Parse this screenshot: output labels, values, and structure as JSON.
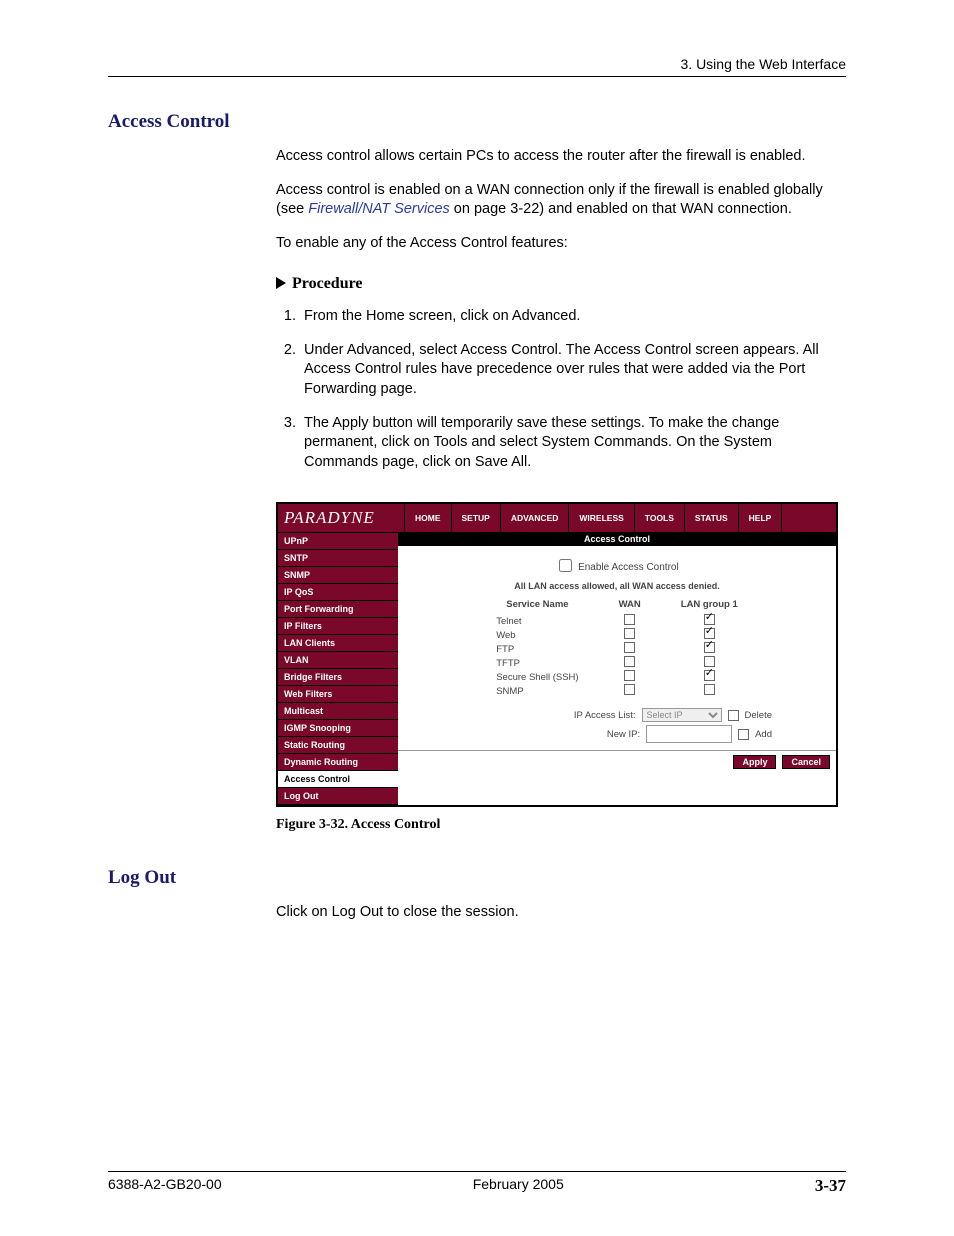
{
  "header": {
    "breadcrumb": "3. Using the Web Interface"
  },
  "sections": {
    "access_control": {
      "title": "Access Control",
      "p1": "Access control allows certain PCs to access the router after the firewall is enabled.",
      "p2_a": "Access control is enabled on a WAN connection only if the firewall is enabled globally (see ",
      "p2_link": "Firewall/NAT Services",
      "p2_b": " on page 3-22) and enabled on that WAN connection.",
      "p3": "To enable any of the Access Control features:",
      "procedure_label": "Procedure",
      "steps": [
        "From the Home screen, click on Advanced.",
        "Under Advanced, select Access Control. The Access Control screen appears. All Access Control rules have precedence over rules that were added via the Port Forwarding page.",
        "The Apply button will temporarily save these settings. To make the change permanent, click on Tools and select System Commands. On the System Commands page, click on Save All."
      ],
      "figure_caption": "Figure 3-32.   Access Control"
    },
    "log_out": {
      "title": "Log Out",
      "p1": "Click on Log Out to close the session."
    }
  },
  "screenshot": {
    "logo": "PARADYNE",
    "tabs": [
      "HOME",
      "SETUP",
      "ADVANCED",
      "WIRELESS",
      "TOOLS",
      "STATUS",
      "HELP"
    ],
    "sidebar": [
      "UPnP",
      "SNTP",
      "SNMP",
      "IP QoS",
      "Port Forwarding",
      "IP Filters",
      "LAN Clients",
      "VLAN",
      "Bridge Filters",
      "Web Filters",
      "Multicast",
      "IGMP Snooping",
      "Static Routing",
      "Dynamic Routing",
      "Access Control",
      "Log Out"
    ],
    "sidebar_active_index": 14,
    "panel_title": "Access Control",
    "enable_label": "Enable Access Control",
    "status_msg": "All LAN access allowed, all WAN access denied.",
    "cols": {
      "name": "Service Name",
      "wan": "WAN",
      "lan": "LAN group 1"
    },
    "services": [
      {
        "name": "Telnet",
        "wan": false,
        "lan": true
      },
      {
        "name": "Web",
        "wan": false,
        "lan": true
      },
      {
        "name": "FTP",
        "wan": false,
        "lan": true
      },
      {
        "name": "TFTP",
        "wan": false,
        "lan": false
      },
      {
        "name": "Secure Shell (SSH)",
        "wan": false,
        "lan": true
      },
      {
        "name": "SNMP",
        "wan": false,
        "lan": false
      }
    ],
    "ip_access_list_label": "IP Access List:",
    "ip_select_placeholder": "Select IP",
    "delete_label": "Delete",
    "new_ip_label": "New IP:",
    "add_label": "Add",
    "apply_btn": "Apply",
    "cancel_btn": "Cancel"
  },
  "footer": {
    "doc_id": "6388-A2-GB20-00",
    "date": "February 2005",
    "page": "3-37"
  }
}
